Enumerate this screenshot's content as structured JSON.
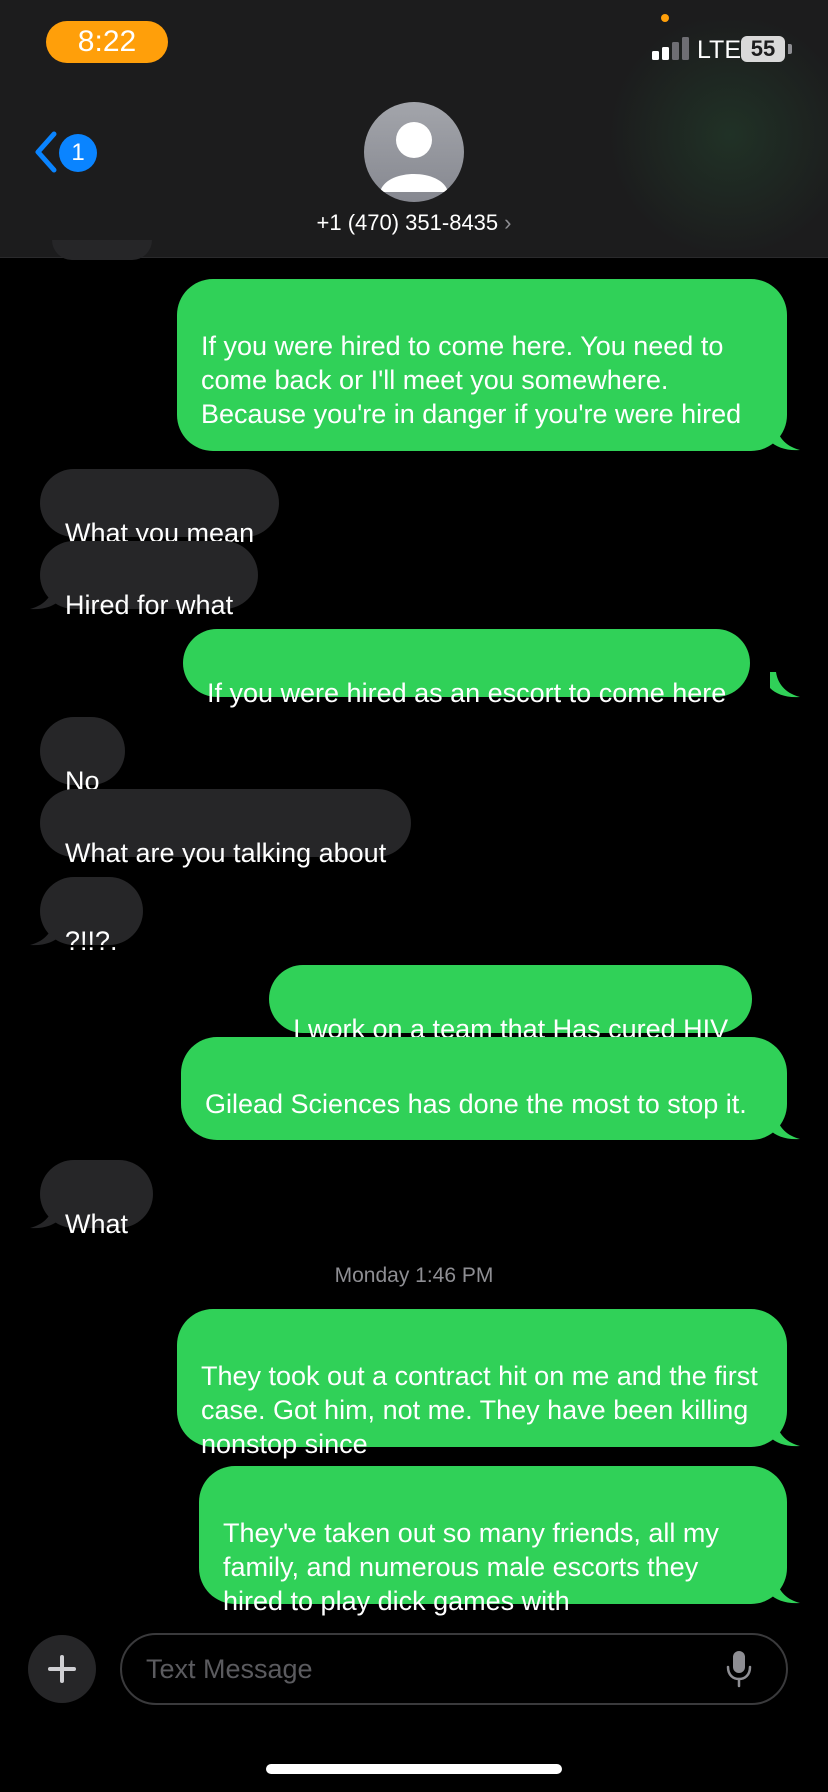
{
  "status_bar": {
    "time": "8:22",
    "network": "LTE",
    "battery": "55",
    "signal_bars_active": 2,
    "signal_bars_total": 4
  },
  "header": {
    "back_badge": "1",
    "contact": "+1 (470) 351-8435",
    "contact_chevron": "›"
  },
  "messages": [
    {
      "text": "If you were hired to come here. You need to come back or I'll meet you somewhere. Because you're in danger if you're were hired",
      "direction": "sent"
    },
    {
      "text": "What you mean",
      "direction": "received"
    },
    {
      "text": "Hired for what",
      "direction": "received"
    },
    {
      "text": "If you were hired as an escort to come here",
      "direction": "sent"
    },
    {
      "text": "No",
      "direction": "received"
    },
    {
      "text": "What are you talking about",
      "direction": "received"
    },
    {
      "text": "?!!?.",
      "direction": "received"
    },
    {
      "text": "I work on a team that Has cured HIV",
      "direction": "sent"
    },
    {
      "text": "Gilead Sciences has done the most to stop it.",
      "direction": "sent"
    },
    {
      "text": "What",
      "direction": "received"
    },
    {
      "text": "They took out a contract hit on me and the first case. Got him, not me. They have been killing nonstop since",
      "direction": "sent"
    },
    {
      "text": "They've taken out so many friends, all my family, and numerous male escorts they hired to play dick games with",
      "direction": "sent"
    }
  ],
  "timestamp": {
    "day": "Monday",
    "time": "1:46 PM"
  },
  "composer": {
    "placeholder": "Text Message"
  },
  "colors": {
    "sent_bubble": "#30d158",
    "received_bubble": "#262628",
    "accent": "#0a84ff",
    "time_pill": "#ff9f0a"
  },
  "icons": {
    "back": "chevron-left-icon",
    "avatar": "person-icon",
    "add": "plus-icon",
    "dictation": "microphone-icon"
  }
}
